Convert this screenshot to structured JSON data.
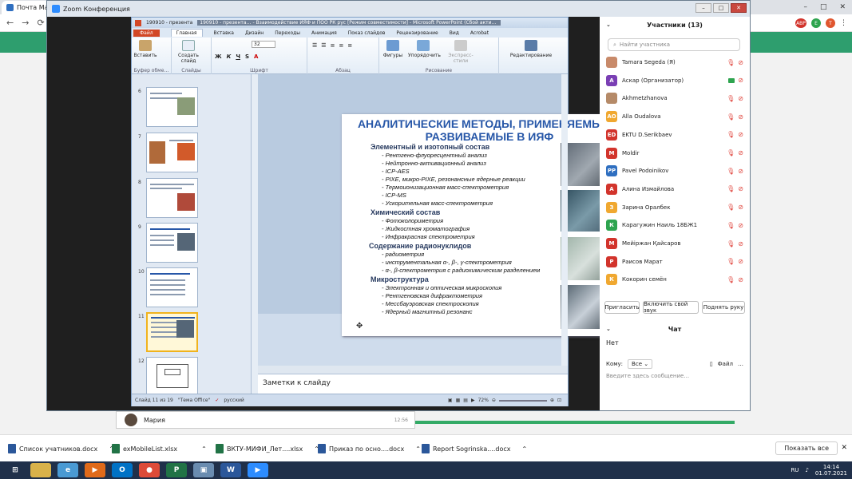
{
  "browser": {
    "tab_title": "Почта Mai",
    "right_badges": [
      "ABP",
      "E",
      "T"
    ]
  },
  "zoom": {
    "window_title": "Zoom Конференция",
    "participants_header": "Участники (13)",
    "search_placeholder": "Найти участника",
    "participants": [
      {
        "name": "Tamara Segeda (Я)",
        "initial": "",
        "color": "#c88a6a"
      },
      {
        "name": "Аскар (Организатор)",
        "initial": "А",
        "color": "#7a3fb4"
      },
      {
        "name": "Akhmetzhanova",
        "initial": "",
        "color": "#b58a68"
      },
      {
        "name": "Alla Oudalova",
        "initial": "AO",
        "color": "#f0a830"
      },
      {
        "name": "EKTU D.Serikbaev",
        "initial": "ED",
        "color": "#d2342c"
      },
      {
        "name": "Moldir",
        "initial": "M",
        "color": "#d2342c"
      },
      {
        "name": "Pavel Podoinikov",
        "initial": "PP",
        "color": "#2f6fc0"
      },
      {
        "name": "Алина Измайлова",
        "initial": "А",
        "color": "#d2342c"
      },
      {
        "name": "Зарина Оралбек",
        "initial": "З",
        "color": "#f0a830"
      },
      {
        "name": "Карагужин Наиль 18БЖ1",
        "initial": "К",
        "color": "#2ea44f"
      },
      {
        "name": "Мейіржан Қайсаров",
        "initial": "М",
        "color": "#d2342c"
      },
      {
        "name": "Раисов Марат",
        "initial": "Р",
        "color": "#d2342c"
      },
      {
        "name": "Кокорин семён",
        "initial": "К",
        "color": "#f0a830"
      }
    ],
    "buttons": {
      "invite": "Пригласить",
      "unmute": "Включить свой звук",
      "raise_hand": "Поднять руку"
    },
    "chat": {
      "header": "Чат",
      "empty": "Нет",
      "to_label": "Кому:",
      "to_value": "Все",
      "file": "Файл",
      "placeholder": "Введите здесь сообщение..."
    }
  },
  "ppt": {
    "title": "190910 - презента… - Взаимодействие ИЯФ и ПОО РК рус [Режим совместимости] - Microsoft PowerPoint (Сбой акти…",
    "title_short": "190910 - презента",
    "tabs": [
      "Файл",
      "Главная",
      "Вставка",
      "Дизайн",
      "Переходы",
      "Анимация",
      "Показ слайдов",
      "Рецензирование",
      "Вид",
      "Acrobat"
    ],
    "groups": {
      "clipboard": "Буфер обме…",
      "slides": "Слайды",
      "font": "Шрифт",
      "paragraph": "Абзац",
      "drawing": "Рисование"
    },
    "ribbon_buttons": {
      "paste": "Вставить",
      "create_slide": "Создать слайд",
      "shapes": "Фигуры",
      "arrange": "Упорядочить",
      "quick_styles": "Экспресс-стили",
      "editing": "Редактирование",
      "font_size": "32"
    },
    "thumb_numbers": [
      "6",
      "7",
      "8",
      "9",
      "10",
      "11",
      "12"
    ],
    "notes": "Заметки к слайду",
    "status": {
      "slide": "Слайд 11 из 19",
      "theme": "\"Тема Office\"",
      "lang": "русский",
      "zoom": "72%"
    },
    "slide": {
      "title": "АНАЛИТИЧЕСКИЕ МЕТОДЫ, ПРИМЕНЯЕМЫЕ И РАЗВИВАЕМЫЕ В ИЯФ",
      "sections": [
        {
          "head": "Элементный и изотопный состав",
          "items": [
            "- Рентгено-флуоресцентный  анализ",
            "- Нейтронно-активационный  анализ",
            "- ICP-AES",
            "- PIXE, микро-PIXE, резонансные ядерные реакции",
            "- Термоионизационная  масс-спектрометрия",
            "- ICP-MS",
            "- Ускорительная  масс-спектрометрия"
          ]
        },
        {
          "head": "Химический состав",
          "items": [
            "- Фотоколориметрия",
            "- Жидкостная  хроматография",
            "- Инфракрасная  спектрометрия"
          ]
        },
        {
          "head": "Содержание радионуклидов",
          "items": [
            "- радиометрия",
            "- инструментальная  α-, β-, γ-спектрометрия",
            "- α-, β-спектрометрия с радиохимическим разделением"
          ]
        },
        {
          "head": "Микроструктура",
          "items": [
            "- Электронная  и оптическая микроскопия",
            "- Рентгеновская  дифрактометрия",
            "- Мессбауэровская  спектроскопия",
            "- Ядерный магнитный резонанс"
          ]
        }
      ]
    }
  },
  "chat_strip": {
    "name": "Мария",
    "time": "12:56"
  },
  "downloads": [
    "Список учатников.docx",
    "exMobileList.xlsx",
    "ВКТУ-МИФИ_Лет....xlsx",
    "Приказ по осно....docx",
    "Report Sogrinska....docx"
  ],
  "show_all": "Показать все",
  "tray": {
    "lang": "RU",
    "time": "14:14",
    "date": "01.07.2021"
  }
}
